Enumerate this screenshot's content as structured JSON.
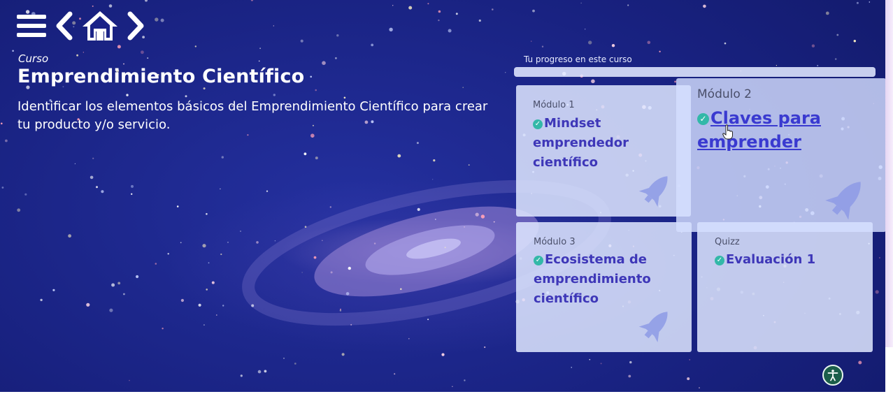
{
  "nav": {
    "menu_icon": "hamburger-menu-icon",
    "back_icon": "chevron-left-icon",
    "home_icon": "home-icon",
    "forward_icon": "chevron-right-icon"
  },
  "course": {
    "kicker": "Curso",
    "title": "Emprendimiento Científico",
    "description": "Identificar los elementos básicos del Emprendimiento Científico para crear tu producto y/o servicio."
  },
  "progress": {
    "label": "Tu progreso en este curso",
    "value": 1.0
  },
  "modules": [
    {
      "kicker": "Módulo 1",
      "title": "Mindset emprendedor científico",
      "completed": true
    },
    {
      "kicker": "Módulo 2",
      "title": "Claves para emprender",
      "completed": true
    },
    {
      "kicker": "Módulo 3",
      "title": "Ecosistema de emprendimiento científico",
      "completed": true
    },
    {
      "kicker": "Quizz",
      "title": "Evaluación 1",
      "completed": true
    }
  ],
  "colors": {
    "background": "#1a2388",
    "card_title": "#3e37b8",
    "check": "#33b8a8",
    "accessibility": "#1b5e4a"
  },
  "accessibility_icon": "accessibility-icon"
}
